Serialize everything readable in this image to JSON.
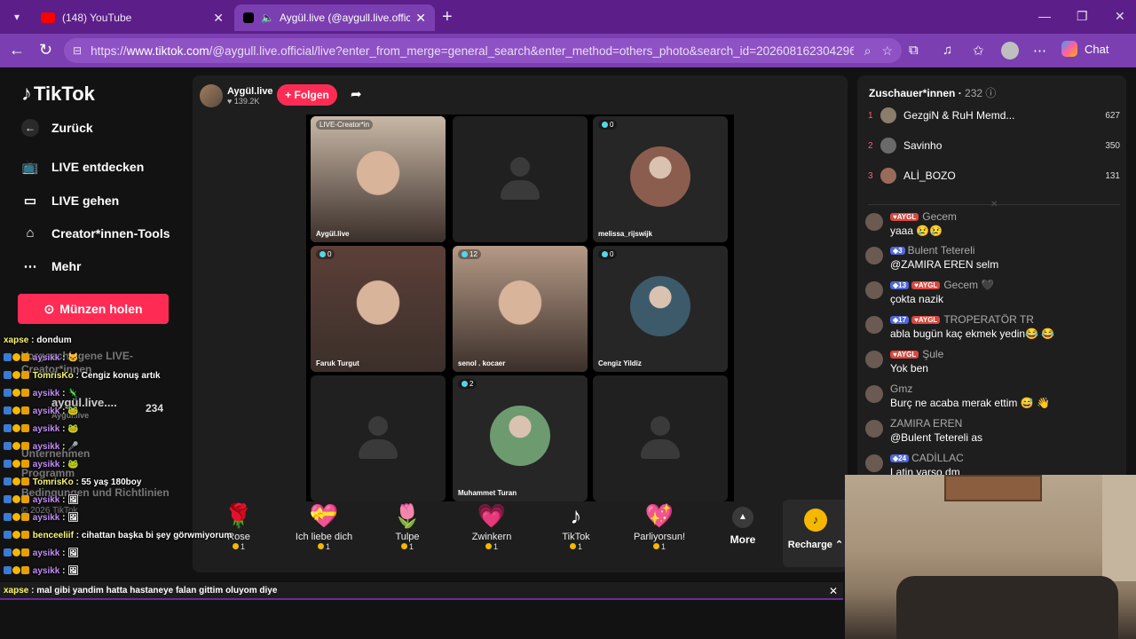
{
  "browser": {
    "tabs": [
      {
        "title": "(148) YouTube",
        "active": false,
        "favicon_color": "#ff0000"
      },
      {
        "title": "Aygül.live (@aygull.live.official",
        "active": true,
        "favicon_color": "#000000"
      }
    ],
    "url_domain": "www.tiktok.com",
    "url_rest": "/@aygull.live.official/live?enter_from_merge=general_search&enter_method=others_photo&search_id=202608162304296...",
    "url_prefix": "https://",
    "chat_label": "Chat"
  },
  "sidebar": {
    "logo": "TikTok",
    "back": "Zurück",
    "items": [
      {
        "label": "LIVE entdecken",
        "icon": "tv-icon"
      },
      {
        "label": "LIVE gehen",
        "icon": "camera-icon"
      },
      {
        "label": "Creator*innen-Tools",
        "icon": "home-icon"
      },
      {
        "label": "Mehr",
        "icon": "more-dots-icon"
      }
    ],
    "coins_button": "Münzen holen",
    "suggested_header": "Vorgeschlagene LIVE-Creator*innen",
    "suggested_name": "aygül.live....",
    "suggested_sub": "Aygül.live",
    "suggested_count": "234",
    "company": "Unternehmen",
    "program": "Programm",
    "terms": "Bedingungen und Richtlinien",
    "copyright": "© 2026 TikTok"
  },
  "live": {
    "host_name": "Aygül.live",
    "host_likes": "139.2K",
    "follow": "+ Folgen",
    "cells": [
      {
        "label": "Aygül.live",
        "badge": "LIVE-Creator*in",
        "type": "video",
        "bg": "#c9b8a6"
      },
      {
        "label": "",
        "badge": "",
        "type": "empty",
        "bg": "#202020"
      },
      {
        "label": "melissa_rijswijk",
        "badge": "0",
        "type": "avatar",
        "bg": "#262626",
        "circle": "#8a5d4e"
      },
      {
        "label": "Faruk Turgut",
        "badge": "0",
        "type": "video",
        "bg": "#5c4038"
      },
      {
        "label": "senol . kocaer",
        "badge": "12",
        "type": "video",
        "bg": "#b59a86"
      },
      {
        "label": "Cengiz Yildiz",
        "badge": "0",
        "type": "avatar",
        "bg": "#262626",
        "circle": "#3c5a6a"
      },
      {
        "label": "",
        "badge": "",
        "type": "empty",
        "bg": "#202020"
      },
      {
        "label": "Muhammet Turan",
        "badge": "2",
        "type": "avatar",
        "bg": "#262626",
        "circle": "#6e9a70"
      },
      {
        "label": "",
        "badge": "",
        "type": "empty",
        "bg": "#202020"
      }
    ],
    "gifts": [
      {
        "name": "Rose",
        "cost": "1",
        "glyph": "🌹"
      },
      {
        "name": "Ich liebe dich",
        "cost": "1",
        "glyph": "💝"
      },
      {
        "name": "Tulpe",
        "cost": "1",
        "glyph": "🌷"
      },
      {
        "name": "Zwinkern",
        "cost": "1",
        "glyph": "💗"
      },
      {
        "name": "TikTok",
        "cost": "1",
        "glyph": "♪"
      },
      {
        "name": "Parliyorsun!",
        "cost": "1",
        "glyph": "💖"
      }
    ],
    "more": "More",
    "recharge": "Recharge"
  },
  "panel": {
    "viewers_label": "Zuschauer*innen",
    "viewers_count": "232",
    "top": [
      {
        "rank": "1",
        "name": "GezgiN & RuH Memd...",
        "score": "627"
      },
      {
        "rank": "2",
        "name": "Savinho",
        "score": "350"
      },
      {
        "rank": "3",
        "name": "ALİ_BOZO",
        "score": "131"
      }
    ],
    "messages": [
      {
        "level": "",
        "fan": "AYGL",
        "user": "Gecem",
        "text": "yaaa 😢😢"
      },
      {
        "level": "3",
        "fan": "",
        "user": "Bulent Tetereli",
        "text": "@ZAMIRA EREN selm"
      },
      {
        "level": "13",
        "fan": "AYGL",
        "user": "Gecem 🖤",
        "text": "çokta nazik"
      },
      {
        "level": "17",
        "fan": "AYGL",
        "user": "TROPERATÖR TR",
        "text": "abla bugün kaç ekmek yedin😂 😂"
      },
      {
        "level": "",
        "fan": "AYGL",
        "user": "Şule",
        "text": "Yok ben"
      },
      {
        "level": "",
        "fan": "",
        "user": "Gmz",
        "text": "Burç ne acaba merak ettim 😅 👋"
      },
      {
        "level": "",
        "fan": "",
        "user": "ZAMIRA EREN",
        "text": "@Bulent Tetereli as"
      },
      {
        "level": "24",
        "fan": "",
        "user": "CADİLLAC",
        "text": "Latin yarso dm"
      }
    ]
  },
  "overlay": {
    "lines": [
      {
        "user": "xapse",
        "text": "dondum",
        "icons": false
      },
      {
        "user": "aysikk",
        "text": "🐱",
        "icons": true
      },
      {
        "user": "TomrisKo",
        "text": "Cengiz konuş artık",
        "icons": true
      },
      {
        "user": "aysikk",
        "text": "🦎",
        "icons": true
      },
      {
        "user": "aysikk",
        "text": "🐸",
        "icons": true
      },
      {
        "user": "aysikk",
        "text": "🐸",
        "icons": true
      },
      {
        "user": "aysikk",
        "text": "🎤",
        "icons": true
      },
      {
        "user": "aysikk",
        "text": "🐸",
        "icons": true
      },
      {
        "user": "TomrisKo",
        "text": "55 yaş 180boy",
        "icons": true
      },
      {
        "user": "aysikk",
        "text": "🖼",
        "icons": true
      },
      {
        "user": "aysikk",
        "text": "🖼",
        "icons": true
      },
      {
        "user": "benceeliif",
        "text": "cihattan başka bi şey görwmiyorum",
        "icons": true
      },
      {
        "user": "aysikk",
        "text": "🖼",
        "icons": true
      },
      {
        "user": "aysikk",
        "text": "🖼",
        "icons": true
      },
      {
        "user": "aysikk",
        "text": "🖼",
        "icons": true
      }
    ],
    "bottom_user": "xapse",
    "bottom_text": "mal gibi yandim hatta hastaneye falan gittim oluyom diye"
  }
}
